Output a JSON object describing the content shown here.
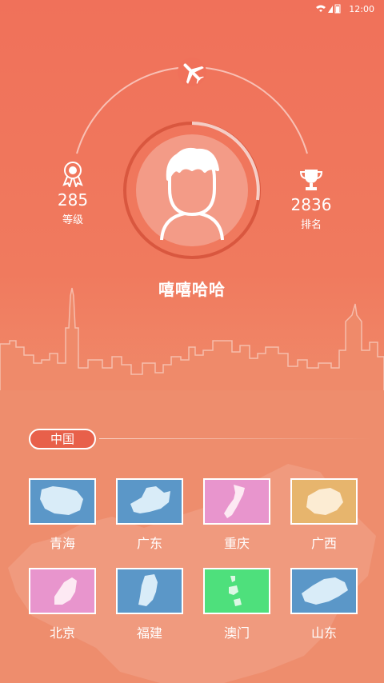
{
  "status": {
    "time": "12:00"
  },
  "profile": {
    "username": "嘻嘻哈哈",
    "level_value": "285",
    "level_label": "等级",
    "rank_value": "2836",
    "rank_label": "排名"
  },
  "region_tab": {
    "label": "中国"
  },
  "provinces": [
    {
      "name": "青海",
      "color": "#5b97c8"
    },
    {
      "name": "广东",
      "color": "#5b97c8"
    },
    {
      "name": "重庆",
      "color": "#e895cd"
    },
    {
      "name": "广西",
      "color": "#e7b56d"
    },
    {
      "name": "北京",
      "color": "#e895cd"
    },
    {
      "name": "福建",
      "color": "#5b97c8"
    },
    {
      "name": "澳门",
      "color": "#4ee07c"
    },
    {
      "name": "山东",
      "color": "#5b97c8"
    }
  ],
  "colors": {
    "accent": "#f0715a",
    "card_shape": "#d9ecf8"
  }
}
